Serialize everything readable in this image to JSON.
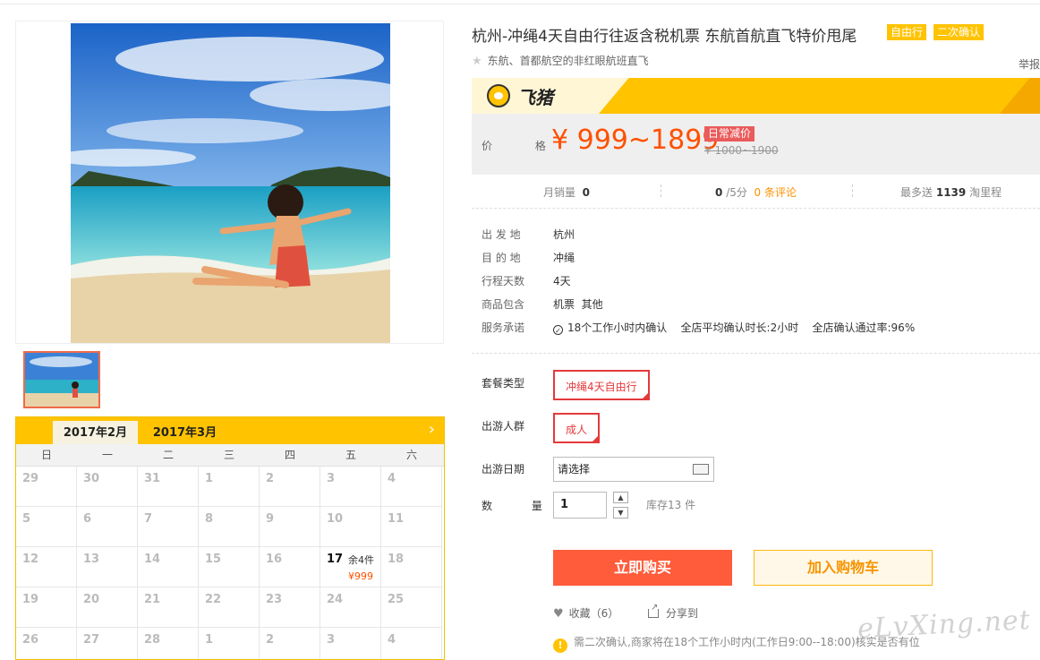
{
  "product": {
    "title": "杭州-冲绳4天自由行往返含税机票 东航首航直飞特价甩尾",
    "tags": [
      "自由行",
      "二次确认"
    ],
    "subtitle": "东航、首都航空的非红眼航班直飞",
    "report": "举报"
  },
  "brand": {
    "logo_text": "飞猪"
  },
  "price": {
    "label": "价 格",
    "current": "¥ 999~1899",
    "promo": "日常减价",
    "original": "¥ 1000~1900"
  },
  "stats": {
    "monthly_sales_label": "月销量",
    "monthly_sales": "0",
    "rating": "0",
    "rating_suffix": "/5分",
    "reviews": "0 条评论",
    "mileage_prefix": "最多送",
    "mileage": "1139",
    "mileage_suffix": "淘里程"
  },
  "info": [
    {
      "key": "出 发 地",
      "value": "杭州"
    },
    {
      "key": "目 的 地",
      "value": "冲绳"
    },
    {
      "key": "行程天数",
      "value": "4天"
    },
    {
      "key": "商品包含",
      "value": "机票  其他"
    }
  ],
  "service": {
    "key": "服务承诺",
    "items": [
      "18个工作小时内确认",
      "全店平均确认时长:2小时",
      "全店确认通过率:96%"
    ]
  },
  "options": {
    "package_label": "套餐类型",
    "package_value": "冲绳4天自由行",
    "crowd_label": "出游人群",
    "crowd_value": "成人",
    "date_label": "出游日期",
    "date_placeholder": "请选择",
    "qty_label": "数 量",
    "qty_value": "1",
    "stock": "库存13 件"
  },
  "actions": {
    "buy": "立即购买",
    "cart": "加入购物车",
    "favorite": "收藏（6）",
    "share": "分享到"
  },
  "notice": "需二次确认,商家将在18个工作小时内(工作日9:00--18:00)核实是否有位",
  "watermark": "eLvXing.net",
  "calendar": {
    "active_month": "2017年2月",
    "next_month": "2017年3月",
    "weekdays": [
      "日",
      "一",
      "二",
      "三",
      "四",
      "五",
      "六"
    ],
    "rows": [
      [
        "29",
        "30",
        "31",
        "1",
        "2",
        "3",
        "4"
      ],
      [
        "5",
        "6",
        "7",
        "8",
        "9",
        "10",
        "11"
      ],
      [
        "12",
        "13",
        "14",
        "15",
        "16",
        "17",
        "18"
      ],
      [
        "19",
        "20",
        "21",
        "22",
        "23",
        "24",
        "25"
      ],
      [
        "26",
        "27",
        "28",
        "1",
        "2",
        "3",
        "4"
      ]
    ],
    "available": {
      "day": "17",
      "stock": "余4件",
      "price": "¥999"
    }
  },
  "colors": {
    "accent": "#ff5000",
    "brand_yellow": "#ffc300",
    "buy_button": "#ff5c3b",
    "selected_border": "#e4393c"
  }
}
